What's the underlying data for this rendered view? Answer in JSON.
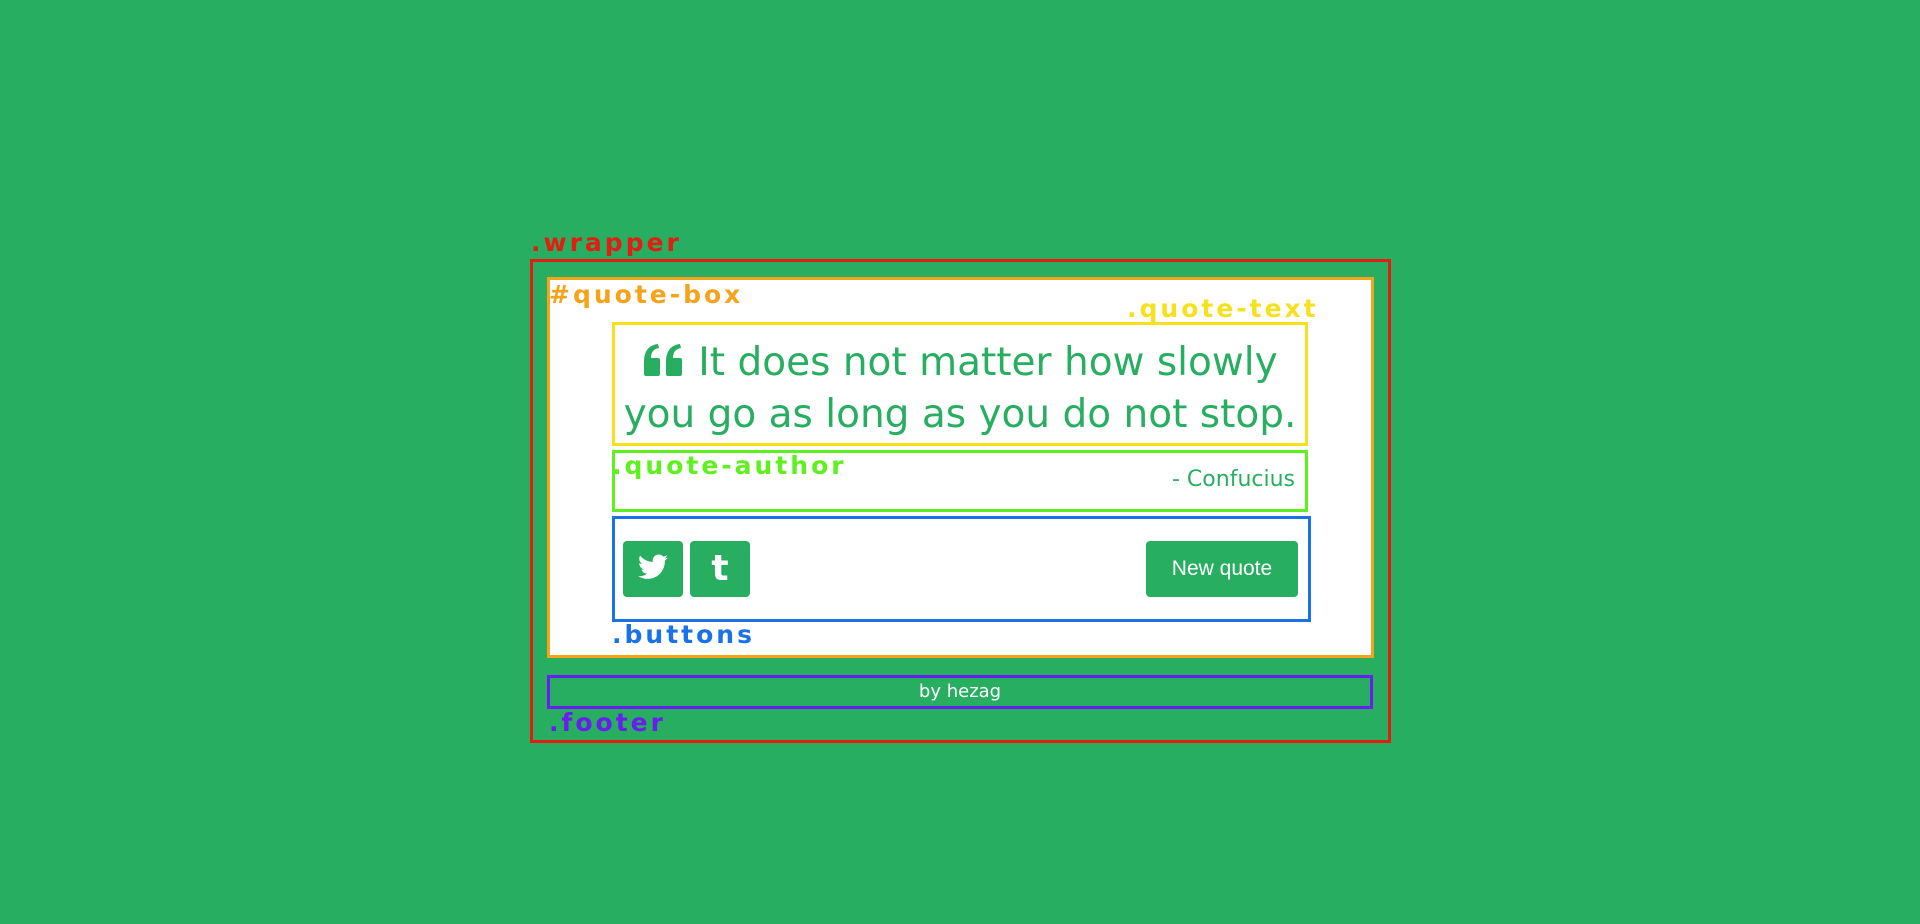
{
  "debug_labels": {
    "wrapper": ".wrapper",
    "quote_box": "#quote-box",
    "quote_text": ".quote-text",
    "quote_author": ".quote-author",
    "buttons": ".buttons",
    "footer": ".footer"
  },
  "quote": {
    "text": "It does not matter how slowly you go as long as you do not stop.",
    "author": "- Confucius",
    "icon": "quote-left-icon"
  },
  "buttons": {
    "twitter_icon": "twitter-icon",
    "tumblr_icon": "tumblr-icon",
    "tumblr_glyph": "t",
    "new_quote_label": "New quote"
  },
  "footer": {
    "credit": "by hezag"
  },
  "colors": {
    "background": "#27ae60",
    "card": "#ffffff",
    "wrapper_outline": "#e31d12",
    "quote_box_outline": "#f5a31a",
    "quote_text_outline": "#f7e11e",
    "quote_author_outline": "#5ff01f",
    "buttons_outline": "#1a72e8",
    "footer_outline": "#6a1df0"
  }
}
